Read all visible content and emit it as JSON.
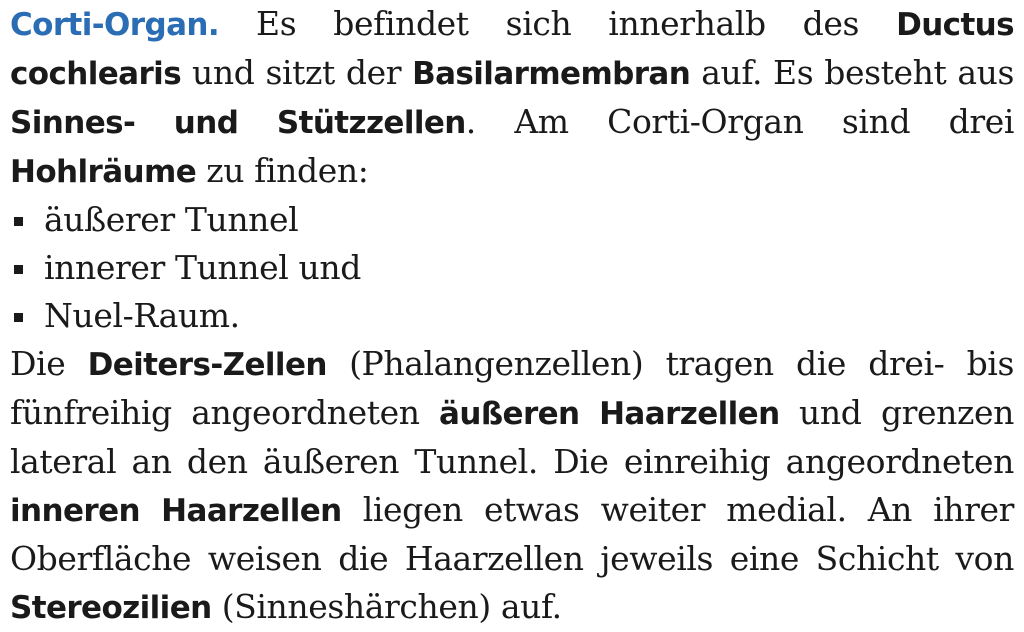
{
  "paragraph1": {
    "heading": "Corti-Organ.",
    "t1": " Es befindet sich innerhalb des ",
    "b1": "Ductus cochlearis",
    "t2": " und sitzt der ",
    "b2": "Basilarmembran",
    "t3": " auf. Es besteht aus ",
    "b3": "Sinnes- und Stützzellen",
    "t4": ". Am Corti-Organ sind drei ",
    "b4": "Hohlräume",
    "t5": " zu finden:"
  },
  "list": {
    "items": [
      "äußerer Tunnel",
      "innerer Tunnel und",
      "Nuel-Raum."
    ]
  },
  "paragraph2": {
    "t1": "Die ",
    "b1": "Deiters-Zellen",
    "t2": " (Phalangenzellen) tragen die drei- bis fünfrei­hig angeordneten ",
    "b2": "äußeren Haarzellen",
    "t3": " und grenzen lateral an den äußeren Tunnel. Die einreihig angeordneten ",
    "b3": "inneren Haar­zellen",
    "t4": " liegen etwas weiter medial. An ihrer Oberfläche weisen die Haarzellen jeweils eine Schicht von ",
    "b4": "Stereozilien",
    "t5": " (Sinneshär­chen) auf."
  }
}
